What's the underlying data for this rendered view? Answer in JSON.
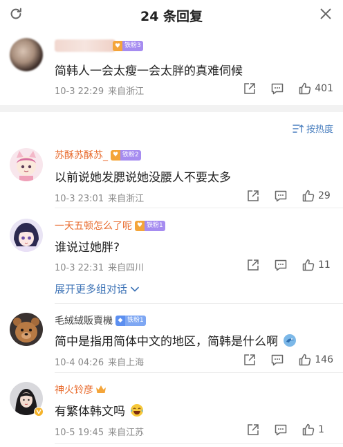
{
  "header": {
    "title": "24 条回复"
  },
  "sort": {
    "label": "按热度"
  },
  "top_comment": {
    "badge": "铁粉3",
    "text": "简韩人一会太瘦一会太胖的真难伺候",
    "date": "10-3 22:29",
    "location": "来自浙江",
    "likes": "401"
  },
  "comments": [
    {
      "user": "苏酥苏酥苏_",
      "badge": "铁粉2",
      "text": "以前说她发腮说她没腰人不要太多",
      "date": "10-3 23:01",
      "location": "来自浙江",
      "likes": "29"
    },
    {
      "user": "一天五顿怎么了呢",
      "badge": "铁粉1",
      "text": "谁说过她胖?",
      "date": "10-3 22:31",
      "location": "来自四川",
      "likes": "11"
    },
    {
      "user": "毛絨絨販賣機",
      "badge": "铁粉1",
      "text": "简中是指用简体中文的地区，简韩是什么啊",
      "date": "10-4 04:26",
      "location": "来自上海",
      "likes": "146"
    },
    {
      "user": "神火铃彦",
      "badge": "",
      "text": "有繁体韩文吗",
      "date": "10-5 19:45",
      "location": "来自江苏",
      "likes": "1"
    }
  ],
  "expand": {
    "label": "展开更多组对话"
  },
  "colors": {
    "username": "#e86a2c",
    "link": "#3d73b6",
    "meta": "#8a8a8a"
  }
}
